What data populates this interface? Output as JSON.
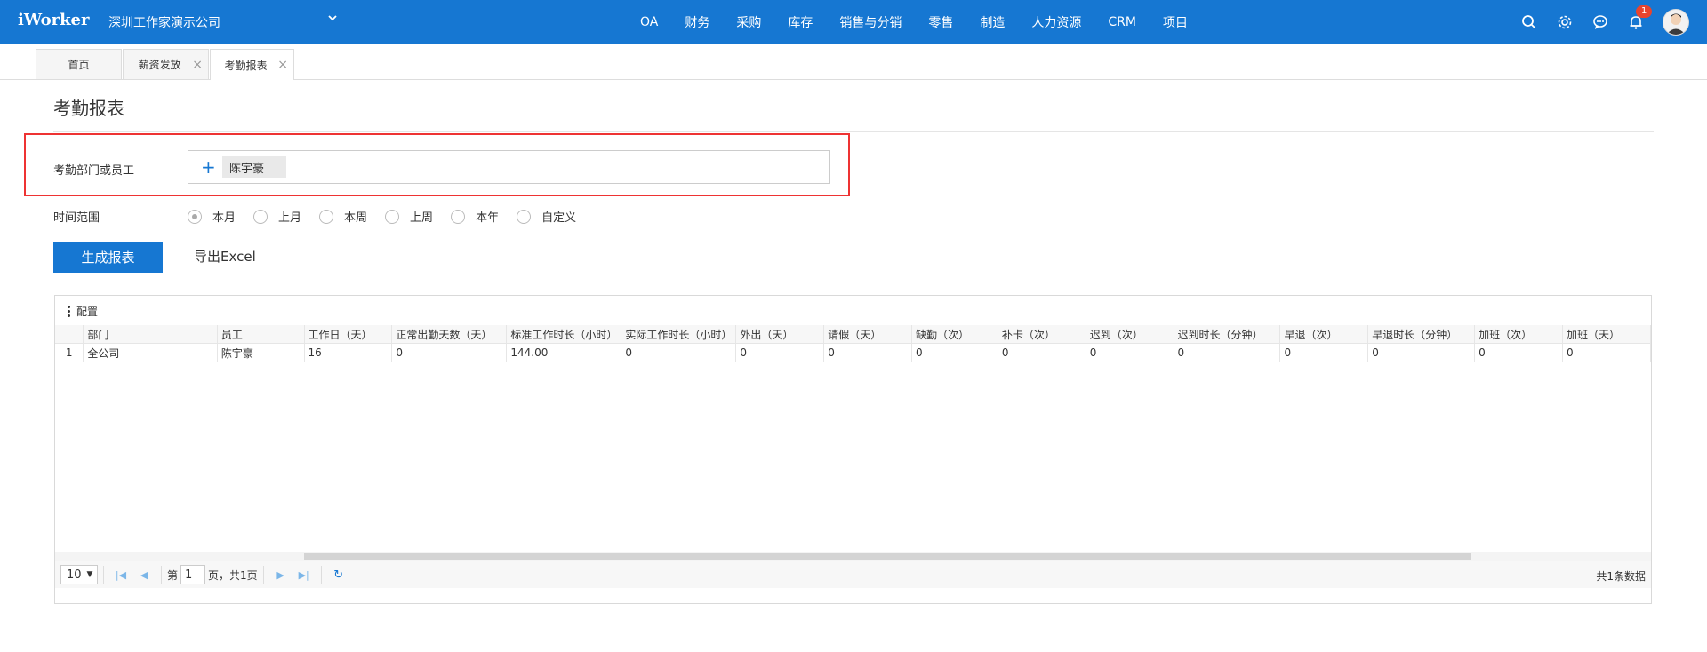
{
  "header": {
    "logo": "iWorker",
    "company": "深圳工作家演示公司",
    "nav": [
      "OA",
      "财务",
      "采购",
      "库存",
      "销售与分销",
      "零售",
      "制造",
      "人力资源",
      "CRM",
      "项目"
    ],
    "icons": [
      "search-icon",
      "gear-icon",
      "chat-icon",
      "bell-icon"
    ],
    "notification_count": "1"
  },
  "tabs": [
    {
      "label": "首页",
      "closable": false
    },
    {
      "label": "薪资发放",
      "closable": true
    },
    {
      "label": "考勤报表",
      "closable": true,
      "active": true
    }
  ],
  "page": {
    "title": "考勤报表",
    "dept_label": "考勤部门或员工",
    "selected_employee": "陈宇豪",
    "time_label": "时间范围",
    "time_options": [
      "本月",
      "上月",
      "本周",
      "上周",
      "本年",
      "自定义"
    ],
    "time_selected": "本月",
    "generate_label": "生成报表",
    "export_label": "导出Excel"
  },
  "grid": {
    "config_label": "配置",
    "columns": [
      "部门",
      "员工",
      "工作日（天）",
      "正常出勤天数（天）",
      "标准工作时长（小时）",
      "实际工作时长（小时）",
      "外出（天）",
      "请假（天）",
      "缺勤（次）",
      "补卡（次）",
      "迟到（次）",
      "迟到时长（分钟）",
      "早退（次）",
      "早退时长（分钟）",
      "加班（次）",
      "加班（天）"
    ],
    "rows": [
      [
        "1",
        "全公司",
        "陈宇豪",
        "16",
        "0",
        "144.00",
        "0",
        "0",
        "0",
        "0",
        "0",
        "0",
        "0",
        "0",
        "0",
        "0",
        "0"
      ]
    ],
    "pager": {
      "page_size": "10",
      "page_prefix": "第",
      "page_value": "1",
      "page_suffix": "页，共1页",
      "total": "共1条数据"
    }
  },
  "colors": {
    "primary": "#1677d2",
    "highlight_border": "#e33333"
  }
}
